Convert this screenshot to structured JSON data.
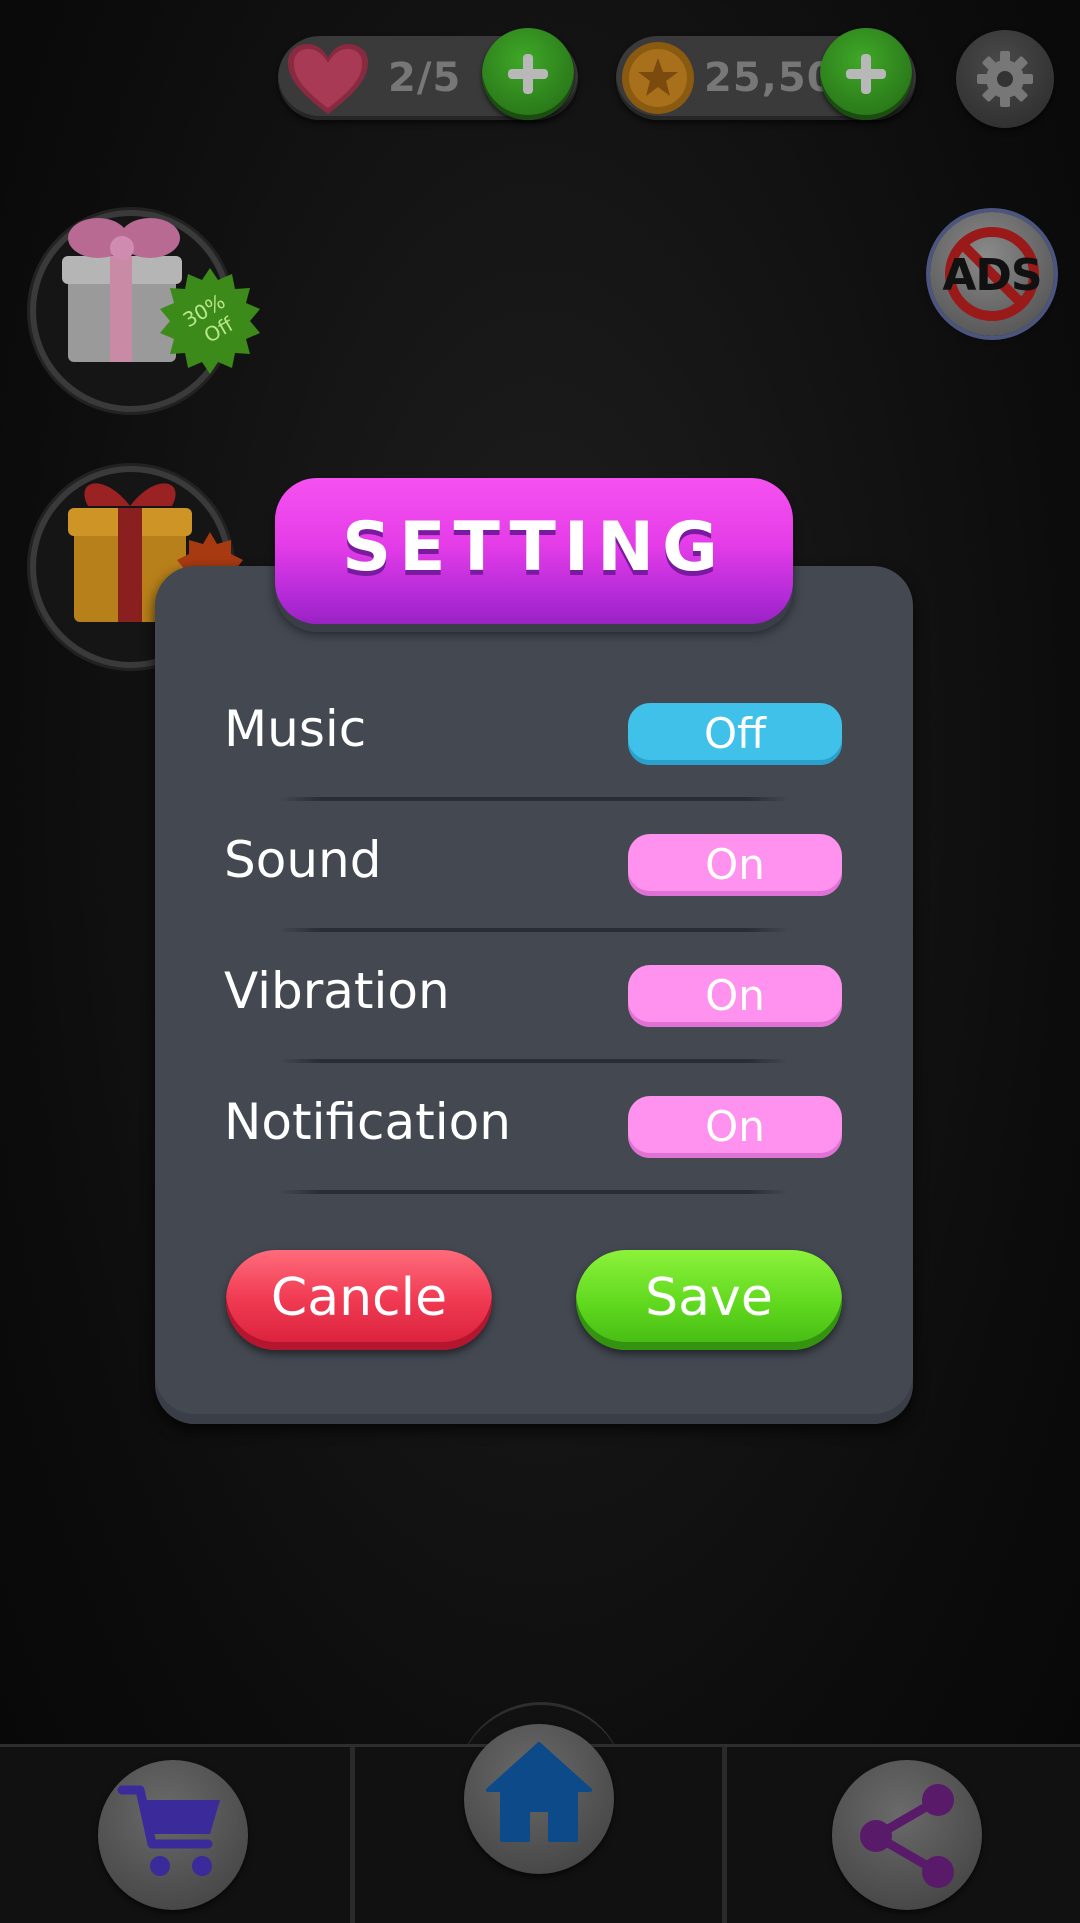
{
  "hud": {
    "lives": "2/5",
    "coins": "25,50"
  },
  "promo": {
    "discount_line1": "30%",
    "discount_line2": "Off",
    "no_ads_label": "ADS"
  },
  "dialog": {
    "title": "SETTING",
    "settings": [
      {
        "label": "Music",
        "state": "Off"
      },
      {
        "label": "Sound",
        "state": "On"
      },
      {
        "label": "Vibration",
        "state": "On"
      },
      {
        "label": "Notification",
        "state": "On"
      }
    ],
    "cancel_label": "Cancle",
    "save_label": "Save"
  },
  "colors": {
    "title_pink": "#e53de8",
    "toggle_off": "#3fc1ea",
    "toggle_on": "#ff92ee",
    "cancel_red": "#f03a52",
    "save_green": "#5fd81e",
    "panel": "#434851"
  },
  "nav": {
    "icons": [
      "cart-icon",
      "home-icon",
      "share-icon"
    ]
  }
}
